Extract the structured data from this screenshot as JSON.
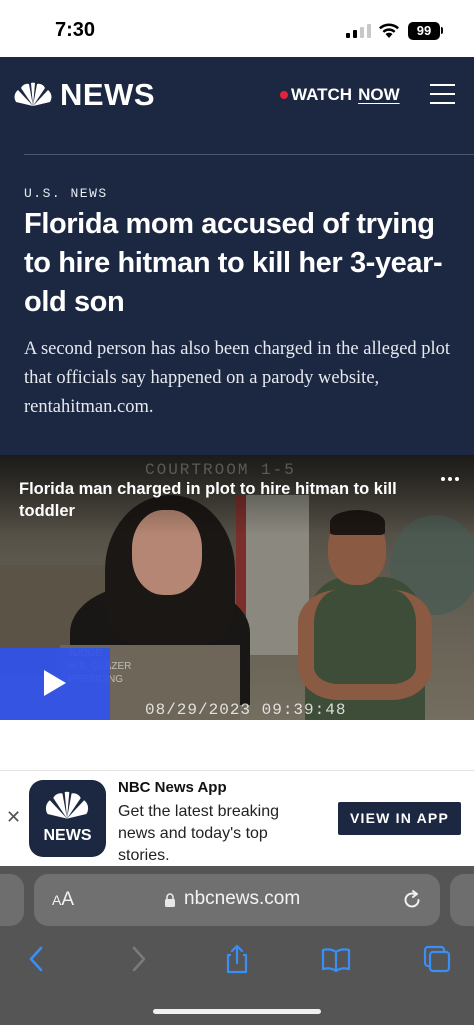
{
  "status_bar": {
    "time": "7:30",
    "battery": "99",
    "signal_bars_active": 2
  },
  "header": {
    "logo": "NEWS",
    "watch": "WATCH",
    "now": "NOW"
  },
  "article": {
    "section": "U.S. NEWS",
    "headline": "Florida mom accused of trying to hire hitman to kill her 3-year-old son",
    "dek": "A second person has also been charged in the alleged plot that officials say happened on a parody website, rentahitman.com."
  },
  "video": {
    "title": "Florida man charged in plot to hire hitman to kill toddler",
    "courtroom_label": "COURTROOM 1-5",
    "lower_third_line1": "JUDGE",
    "lower_third_line2": "M  S. GLAZER",
    "lower_third_line3": "PRESIDING",
    "timestamp": "08/29/2023  09:39:48"
  },
  "app_banner": {
    "icon_label": "NEWS",
    "app_name": "NBC News App",
    "description": "Get the latest breaking news and today's top stories.",
    "cta": "VIEW IN APP"
  },
  "browser": {
    "aa_small": "A",
    "aa_big": "A",
    "url": "nbcnews.com"
  },
  "colors": {
    "brand_navy": "#1c2841",
    "live_red": "#e3223b",
    "play_blue": "#3052ed",
    "safari_gray": "#555555",
    "ios_blue": "#3a8ef6"
  },
  "icons": [
    "peacock-logo",
    "menu-icon",
    "more-icon",
    "play-icon",
    "close-icon",
    "lock-icon",
    "reload-icon",
    "back-icon",
    "forward-icon",
    "share-icon",
    "bookmarks-icon",
    "tabs-icon"
  ]
}
